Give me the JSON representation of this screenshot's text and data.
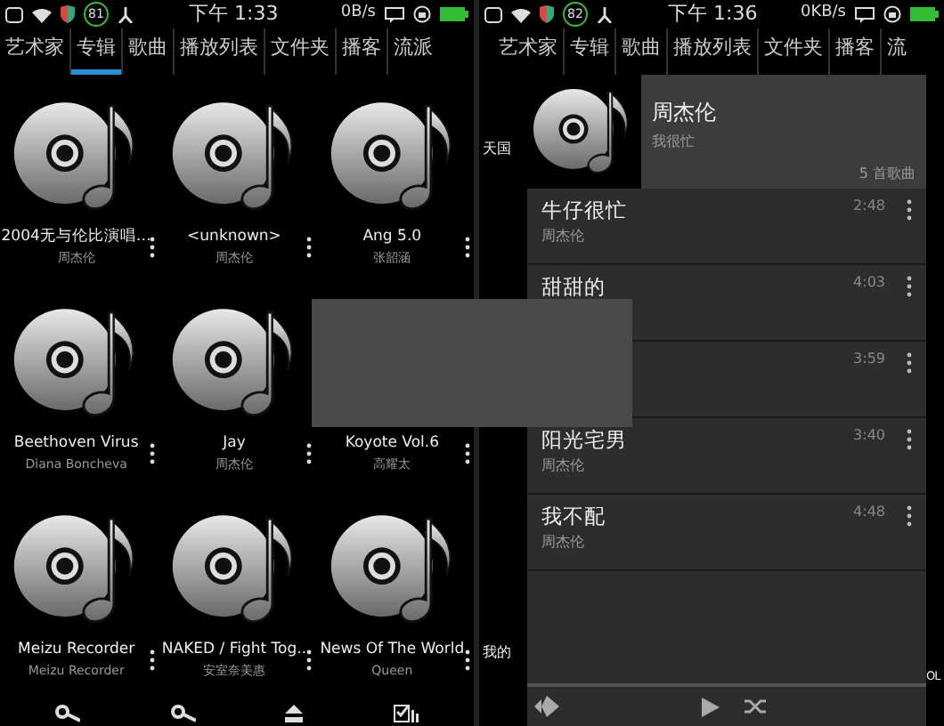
{
  "left_screen": {
    "status_bar": {
      "badge": "81",
      "time": "下午 1:33",
      "speed": "0B/s"
    },
    "tabs": [
      {
        "label": "艺术家",
        "selected": false
      },
      {
        "label": "专辑",
        "selected": true
      },
      {
        "label": "歌曲",
        "selected": false
      },
      {
        "label": "播放列表",
        "selected": false
      },
      {
        "label": "文件夹",
        "selected": false
      },
      {
        "label": "播客",
        "selected": false
      },
      {
        "label": "流派",
        "selected": false
      }
    ],
    "albums": [
      {
        "kind": "disc",
        "title": "2004无与伦比演唱…",
        "artist": "周杰伦"
      },
      {
        "kind": "disc",
        "title": "<unknown>",
        "artist": "周杰伦"
      },
      {
        "kind": "disc",
        "title": "Ang 5.0",
        "artist": "张韶涵"
      },
      {
        "kind": "disc",
        "title": "Beethoven Virus",
        "artist": "Diana Boncheva"
      },
      {
        "kind": "disc",
        "title": "Jay",
        "artist": "周杰伦"
      },
      {
        "kind": "covered",
        "title": "Koyote Vol.6",
        "artist": "高耀太"
      },
      {
        "kind": "disc",
        "title": "Meizu  Recorder",
        "artist": "Meizu  Recorder"
      },
      {
        "kind": "disc",
        "title": "NAKED / Fight Tog..",
        "artist": "安室奈美惠"
      },
      {
        "kind": "disc",
        "title": "News Of The World",
        "artist": "Queen"
      }
    ]
  },
  "right_screen": {
    "status_bar": {
      "badge": "82",
      "time": "下午 1:36",
      "speed": "0KB/s"
    },
    "tabs": [
      {
        "label": "艺术家",
        "selected": false
      },
      {
        "label": "专辑",
        "selected": false
      },
      {
        "label": "歌曲",
        "selected": false
      },
      {
        "label": "播放列表",
        "selected": false
      },
      {
        "label": "文件夹",
        "selected": false
      },
      {
        "label": "播客",
        "selected": false
      },
      {
        "label": "流",
        "selected": false
      }
    ],
    "background_labels": [
      "天国",
      "我的"
    ],
    "edge_label": "OL",
    "album_popup": {
      "artist": "周杰伦",
      "album": "我很忙",
      "song_count": "5 首歌曲",
      "songs": [
        {
          "title": "牛仔很忙",
          "artist": "周杰伦",
          "duration": "2:48"
        },
        {
          "title": "甜甜的",
          "duration": "4:03"
        },
        {
          "duration": "3:59"
        },
        {
          "title": "阳光宅男",
          "artist": "周杰伦",
          "duration": "3:40"
        },
        {
          "title": "我不配",
          "artist": "周杰伦",
          "duration": "4:48"
        }
      ]
    }
  }
}
